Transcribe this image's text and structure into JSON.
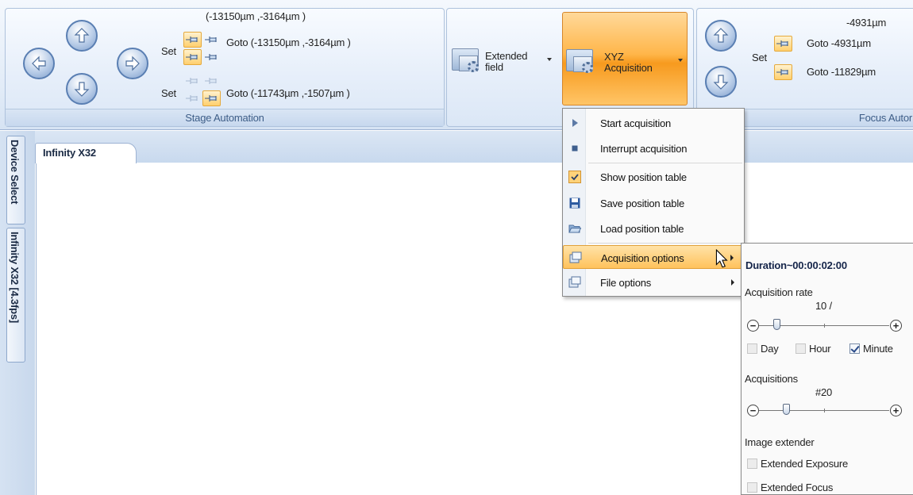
{
  "ribbon": {
    "stage": {
      "current": "(-13150µm ,-3164µm )",
      "set_label": "Set",
      "goto1": "Goto (-13150µm ,-3164µm )",
      "goto2": "Goto (-11743µm ,-1507µm )",
      "caption": "Stage Automation"
    },
    "extended": {
      "line1": "Extended",
      "line2": "field"
    },
    "xyz": {
      "line1": "XYZ",
      "line2": "Acquisition"
    },
    "focus": {
      "current": "-4931µm",
      "set_label": "Set",
      "goto1": "Goto -4931µm",
      "goto2": "Goto -11829µm",
      "caption": "Focus Autor"
    }
  },
  "doc_tab": "Infinity X32",
  "side_tabs": [
    "Device Select",
    "Infinity X32   [4.3fps]"
  ],
  "menu": {
    "items": [
      {
        "label": "Start acquisition",
        "icon": "play-icon"
      },
      {
        "label": "Interrupt acquisition",
        "icon": "stop-icon"
      },
      {
        "label": "Show position table",
        "icon": "checkmark-icon",
        "checked": true
      },
      {
        "label": "Save position table",
        "icon": "floppy-disk-icon"
      },
      {
        "label": "Load position table",
        "icon": "open-folder-icon"
      },
      {
        "label": "Acquisition options",
        "icon": "options-icon",
        "submenu": true,
        "highlighted": true
      },
      {
        "label": "File options",
        "icon": "options-icon",
        "submenu": true
      }
    ]
  },
  "submenu": {
    "duration": "Duration~00:00:02:00",
    "rate_label": "Acquisition rate",
    "rate_value": "10 /",
    "rate_level": 0.11,
    "units": [
      {
        "label": "Day",
        "checked": false
      },
      {
        "label": "Hour",
        "checked": false
      },
      {
        "label": "Minute",
        "checked": true
      }
    ],
    "acq_label": "Acquisitions",
    "acq_value": "#20",
    "acq_level": 0.18,
    "extender_label": "Image extender",
    "ext_exposure": "Extended Exposure",
    "ext_focus": "Extended Focus"
  },
  "colors": {
    "highlight": "#ffc25c",
    "ribbon_blue": "#dbe7f6",
    "accent_orange": "#f79a1e"
  }
}
